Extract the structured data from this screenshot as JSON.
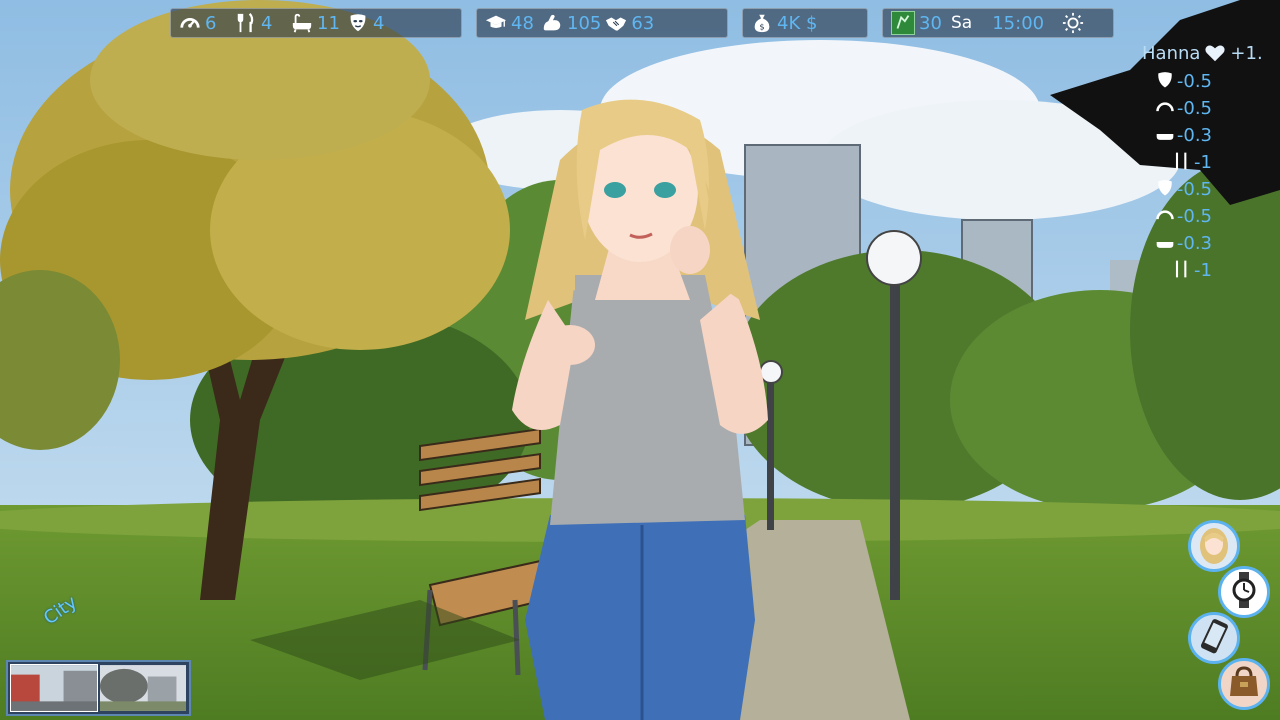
{
  "hud": {
    "needs": [
      {
        "icon": "energy-gauge-icon",
        "value": "6"
      },
      {
        "icon": "fork-knife-icon",
        "value": "4"
      },
      {
        "icon": "bathtub-icon",
        "value": "11"
      },
      {
        "icon": "mood-mask-icon",
        "value": "4"
      }
    ],
    "skills": [
      {
        "icon": "graduation-cap-icon",
        "value": "48"
      },
      {
        "icon": "strength-arm-icon",
        "value": "105"
      },
      {
        "icon": "handshake-icon",
        "value": "63"
      }
    ],
    "money": {
      "icon": "money-bag-icon",
      "value": "4K $"
    },
    "time": {
      "icon": "calendar-icon",
      "day_number": "30",
      "weekday": "Sa",
      "clock": "15:00",
      "weather_icon": "sun-icon"
    }
  },
  "npc": {
    "name": "Hanna",
    "heart_icon": "heart-icon",
    "relationship_delta": "+1.",
    "changes": [
      {
        "icon": "mood-mask-icon",
        "value": "-0.5"
      },
      {
        "icon": "energy-gauge-icon",
        "value": "-0.5"
      },
      {
        "icon": "bathtub-icon",
        "value": "-0.3"
      },
      {
        "icon": "fork-knife-icon",
        "value": "-1"
      },
      {
        "icon": "mood-mask-icon",
        "value": "-0.5"
      },
      {
        "icon": "energy-gauge-icon",
        "value": "-0.5"
      },
      {
        "icon": "bathtub-icon",
        "value": "-0.3"
      },
      {
        "icon": "fork-knife-icon",
        "value": "-1"
      }
    ]
  },
  "location": {
    "name": "City",
    "thumbnails": [
      {
        "label": "street-thumbnail",
        "active": true
      },
      {
        "label": "park-thumbnail",
        "active": false
      }
    ]
  },
  "side_buttons": [
    {
      "icon": "character-portrait-icon"
    },
    {
      "icon": "wristwatch-icon"
    },
    {
      "icon": "smartphone-icon"
    },
    {
      "icon": "handbag-icon"
    }
  ],
  "colors": {
    "hud_value": "#5fb6f0",
    "hud_bg": "#28374b",
    "accent_border": "#5bb2ef",
    "sky": "#9fc6e6",
    "grass": "#6f9a32"
  }
}
